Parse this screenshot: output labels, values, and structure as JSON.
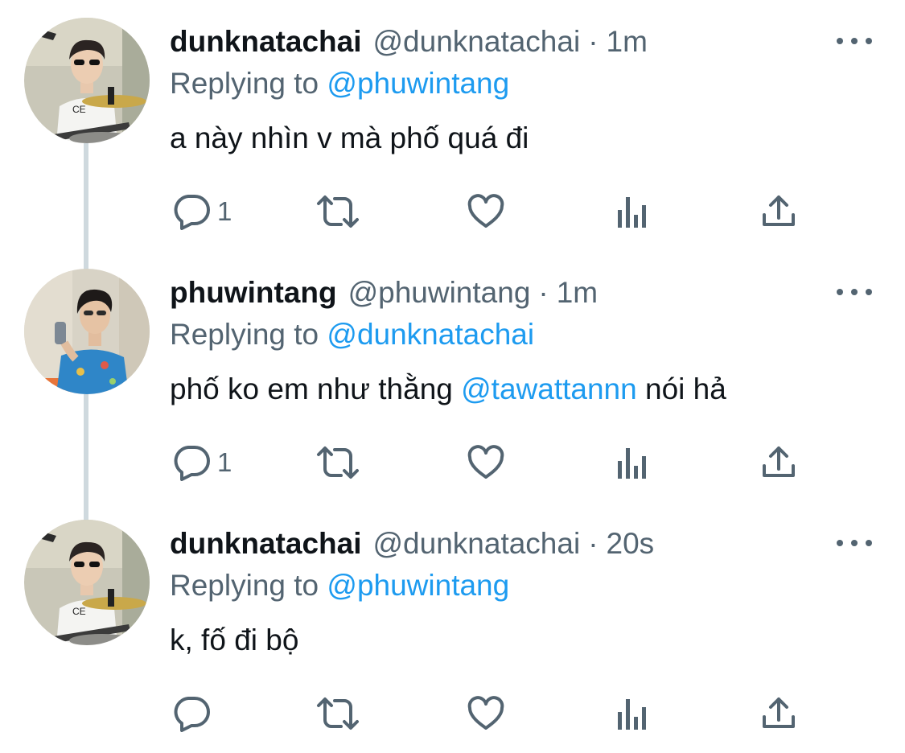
{
  "tweets": [
    {
      "display_name": "dunknatachai",
      "handle": "@dunknatachai",
      "separator": "·",
      "time": "1m",
      "replying_prefix": "Replying to",
      "replying_to": "@phuwintang",
      "text_parts": [
        "a này nhìn v mà phố quá đi",
        "",
        ""
      ],
      "reply_count": "1",
      "avatar_icon": "profile-photo-drummer"
    },
    {
      "display_name": "phuwintang",
      "handle": "@phuwintang",
      "separator": "·",
      "time": "1m",
      "replying_prefix": "Replying to",
      "replying_to": "@dunknatachai",
      "text_parts": [
        "phố ko em như thằng ",
        "@tawattannn",
        " nói hả"
      ],
      "reply_count": "1",
      "avatar_icon": "profile-photo-mirror-selfie"
    },
    {
      "display_name": "dunknatachai",
      "handle": "@dunknatachai",
      "separator": "·",
      "time": "20s",
      "replying_prefix": "Replying to",
      "replying_to": "@phuwintang",
      "text_parts": [
        "k, fố đi bộ",
        "",
        ""
      ],
      "reply_count": "",
      "avatar_icon": "profile-photo-drummer"
    }
  ],
  "colors": {
    "text": "#0f1419",
    "secondary": "#536471",
    "link": "#1d9bf0",
    "thread_line": "#cfd9de"
  },
  "action_icons": [
    "reply-icon",
    "retweet-icon",
    "like-icon",
    "analytics-icon",
    "share-icon"
  ]
}
